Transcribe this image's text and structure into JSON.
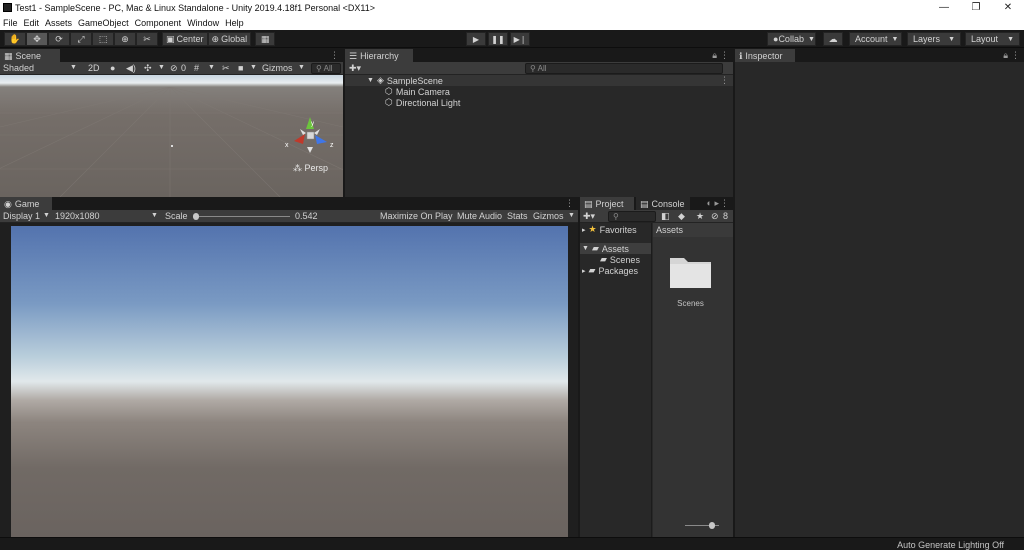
{
  "window": {
    "title": "Test1 - SampleScene - PC, Mac & Linux Standalone - Unity 2019.4.18f1 Personal <DX11>",
    "minimize": "—",
    "maximize": "❐",
    "close": "✕"
  },
  "menu": [
    "File",
    "Edit",
    "Assets",
    "GameObject",
    "Component",
    "Window",
    "Help"
  ],
  "toolbar": {
    "pivot_center": "Center",
    "pivot_global": "Global",
    "collab": "Collab",
    "account": "Account",
    "layers": "Layers",
    "layout": "Layout"
  },
  "scene": {
    "tab": "Scene",
    "shading": "Shaded",
    "mode_2d": "2D",
    "fx_count": "0",
    "gizmos": "Gizmos",
    "search_placeholder": "All",
    "persp_label": "Persp",
    "axis_x": "x",
    "axis_z": "z",
    "axis_y": "y"
  },
  "hierarchy": {
    "tab": "Hierarchy",
    "search_placeholder": "All",
    "scene_name": "SampleScene",
    "objects": [
      "Main Camera",
      "Directional Light"
    ]
  },
  "inspector": {
    "tab": "Inspector"
  },
  "game": {
    "tab": "Game",
    "display": "Display 1",
    "resolution": "1920x1080",
    "scale_label": "Scale",
    "scale_value": "0.542",
    "scale_fraction": 0.0,
    "maximize_on_play": "Maximize On Play",
    "mute_audio": "Mute Audio",
    "stats": "Stats",
    "gizmos": "Gizmos"
  },
  "project": {
    "tab_project": "Project",
    "tab_console": "Console",
    "hidden_count": "8",
    "favorites": "Favorites",
    "assets": "Assets",
    "scenes": "Scenes",
    "packages": "Packages",
    "breadcrumb": "Assets",
    "folder_label": "Scenes"
  },
  "status": {
    "text": "Auto Generate Lighting Off"
  },
  "colors": {
    "background": "#191919",
    "panel": "#282828",
    "tab_active": "#3c3c3c",
    "button": "#3a3a3a",
    "accent_star": "#f2c13c"
  }
}
